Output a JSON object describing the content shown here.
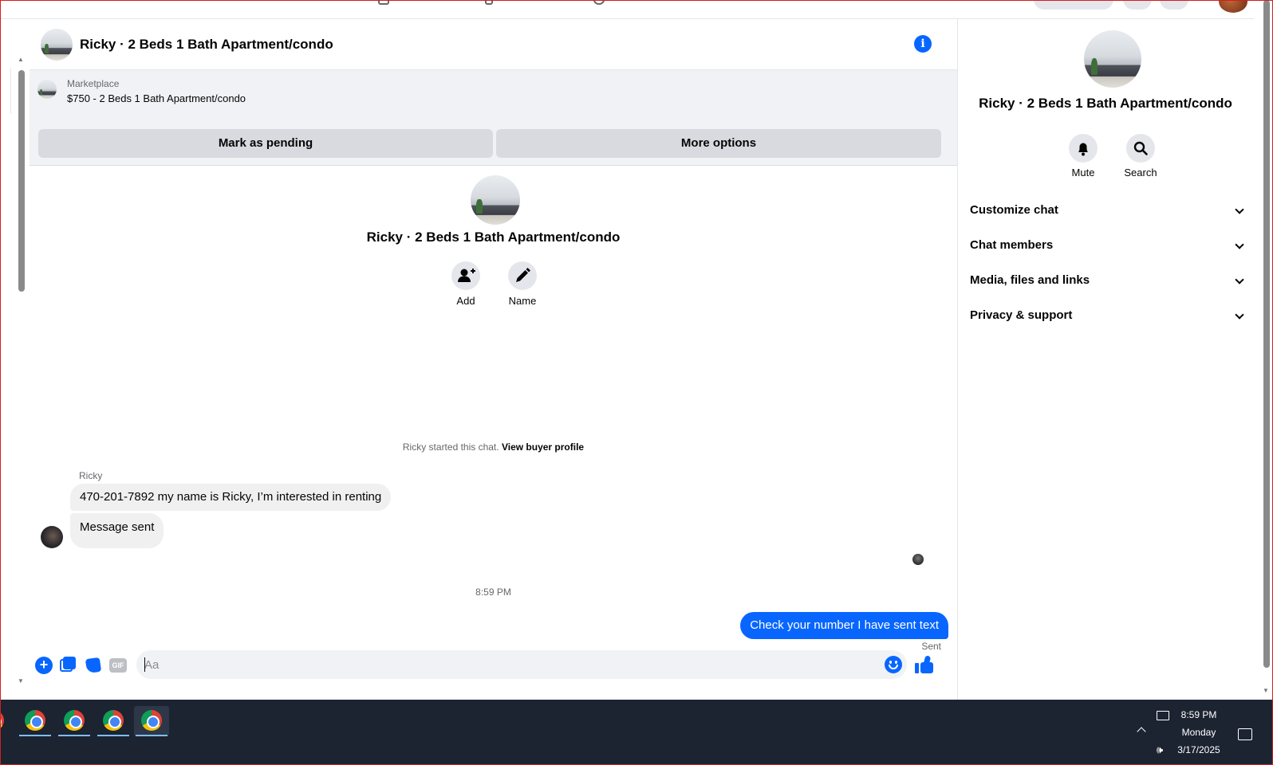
{
  "chat": {
    "title": "Ricky · 2 Beds 1 Bath Apartment/condo",
    "marketplace": {
      "label": "Marketplace",
      "listing": "$750 - 2 Beds 1 Bath Apartment/condo",
      "mark_pending": "Mark as pending",
      "more_options": "More options"
    },
    "intro": {
      "name": "Ricky · 2 Beds 1 Bath Apartment/condo",
      "add_label": "Add",
      "name_label": "Name",
      "started_text": "Ricky started this chat.",
      "view_profile": "View buyer profile"
    },
    "messages": {
      "sender": "Ricky",
      "incoming": [
        "470-201-7892 my name is Ricky, I’m interested in renting",
        "Message sent"
      ],
      "timestamp": "8:59 PM",
      "outgoing": "Check your number I have sent text",
      "status": "Sent"
    },
    "composer": {
      "placeholder": "Aa",
      "gif_label": "GIF",
      "plus_label": "+"
    }
  },
  "sidebar": {
    "name": "Ricky · 2 Beds 1 Bath Apartment/condo",
    "mute_label": "Mute",
    "search_label": "Search",
    "sections": [
      "Customize chat",
      "Chat members",
      "Media, files and links",
      "Privacy & support"
    ]
  },
  "taskbar": {
    "time": "8:59 PM",
    "day": "Monday",
    "date": "3/17/2025"
  },
  "colors": {
    "accent": "#0866ff",
    "bubble_in": "#f0f0f0",
    "taskbar": "#1c2331"
  }
}
